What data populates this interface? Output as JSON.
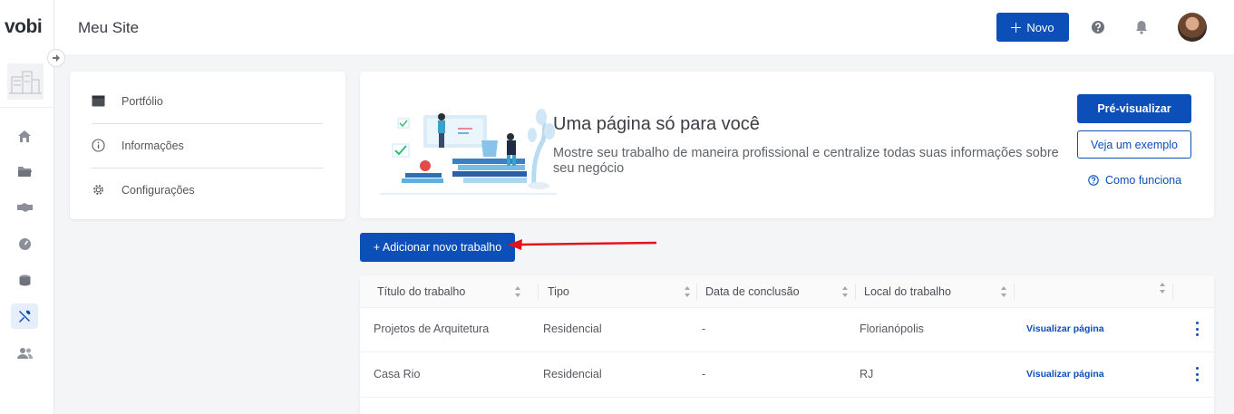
{
  "app": {
    "logo": "vobi"
  },
  "header": {
    "site_title": "Meu Site",
    "new_button": "Novo",
    "new_icon": "plus-icon"
  },
  "rail": {
    "items": [
      {
        "name": "home",
        "icon": "home-icon"
      },
      {
        "name": "projects",
        "icon": "folder-icon"
      },
      {
        "name": "deals",
        "icon": "handshake-icon"
      },
      {
        "name": "dashboard",
        "icon": "gauge-icon"
      },
      {
        "name": "finance",
        "icon": "coins-icon"
      },
      {
        "name": "tools",
        "icon": "tools-icon",
        "active": true
      },
      {
        "name": "team",
        "icon": "users-icon"
      }
    ]
  },
  "settings_menu": {
    "items": [
      {
        "label": "Portfólio",
        "icon": "portfolio-icon"
      },
      {
        "label": "Informações",
        "icon": "info-icon"
      },
      {
        "label": "Configurações",
        "icon": "gear-icon"
      }
    ]
  },
  "hero": {
    "title": "Uma página só para você",
    "description": "Mostre seu trabalho de maneira profissional e centralize todas suas informações sobre seu negócio",
    "preview_button": "Pré-visualizar",
    "example_button": "Veja um exemplo",
    "how_link": "Como funciona"
  },
  "add_button": "+ Adicionar novo trabalho",
  "table": {
    "columns": [
      "Título do trabalho",
      "Tipo",
      "Data de conclusão",
      "Local do trabalho",
      ""
    ],
    "rows": [
      {
        "title": "Projetos de Arquitetura",
        "type": "Residencial",
        "date": "-",
        "location": "Florianópolis",
        "action": "Visualizar página"
      },
      {
        "title": "Casa Rio",
        "type": "Residencial",
        "date": "-",
        "location": "RJ",
        "action": "Visualizar página"
      }
    ]
  },
  "colors": {
    "primary": "#0c4fb8",
    "annotation_arrow": "#e3131b"
  }
}
